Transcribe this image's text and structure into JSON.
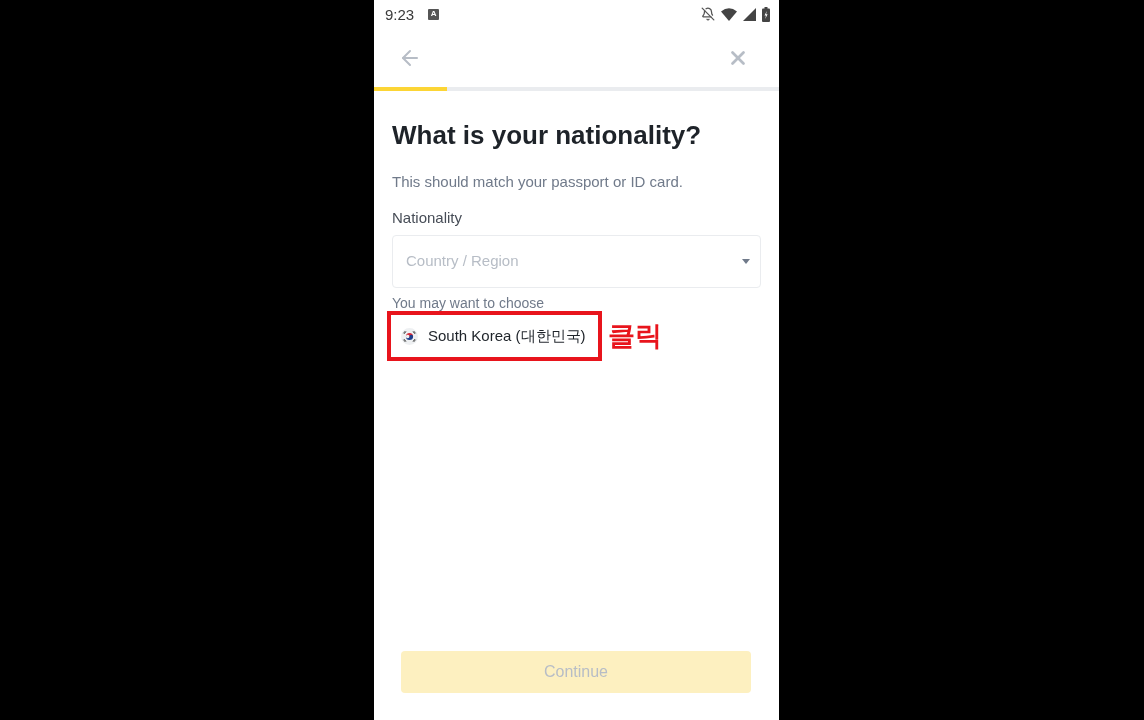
{
  "status_bar": {
    "time": "9:23",
    "notification_glyph": "A"
  },
  "progress": {
    "level": 0.18
  },
  "title": "What is your nationality?",
  "subtitle": "This should match your passport or ID card.",
  "field": {
    "label": "Nationality",
    "placeholder": "Country / Region"
  },
  "suggestions": {
    "heading": "You may want to choose",
    "items": [
      {
        "label": "South Korea (대한민국)",
        "callout": "클릭"
      }
    ]
  },
  "continue_button": {
    "label": "Continue",
    "disabled": true
  }
}
